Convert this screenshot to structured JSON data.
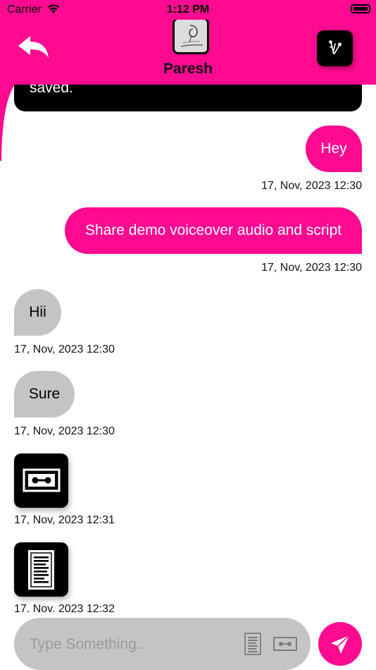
{
  "status_bar": {
    "carrier": "Carrier",
    "time": "1:12 PM"
  },
  "header": {
    "contact_name": "Paresh"
  },
  "colors": {
    "accent": "#ff0a91",
    "incoming_bubble": "#c4c4c4",
    "dark": "#000000"
  },
  "messages": [
    {
      "direction": "out",
      "kind": "text",
      "text": "saved.",
      "style": "dark-partial"
    },
    {
      "direction": "out",
      "kind": "text",
      "text": "Hey",
      "timestamp": "17, Nov, 2023 12:30"
    },
    {
      "direction": "out",
      "kind": "text",
      "text": "Share demo voiceover audio and script",
      "timestamp": "17, Nov, 2023 12:30"
    },
    {
      "direction": "in",
      "kind": "text",
      "text": "Hii",
      "timestamp": "17, Nov, 2023 12:30"
    },
    {
      "direction": "in",
      "kind": "text",
      "text": "Sure",
      "timestamp": "17, Nov, 2023 12:30"
    },
    {
      "direction": "in",
      "kind": "audio",
      "icon": "cassette-icon",
      "timestamp": "17, Nov, 2023 12:31"
    },
    {
      "direction": "in",
      "kind": "document",
      "icon": "document-icon",
      "timestamp": "17. Nov. 2023 12:32"
    }
  ],
  "composer": {
    "placeholder": "Type Something..",
    "value": "",
    "icons": [
      "document-icon",
      "cassette-icon"
    ],
    "send_icon": "send-icon"
  }
}
